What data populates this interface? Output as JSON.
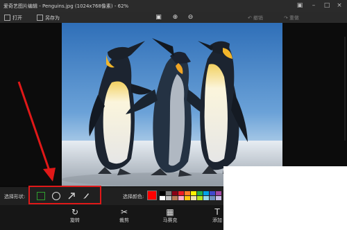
{
  "titlebar": {
    "title": "爱奇艺图片编辑 - Penguins.jpg (1024x768像素) - 62%"
  },
  "toolbar": {
    "open_label": "打开",
    "save_as_label": "另存为",
    "undo_label": "撤销",
    "redo_label": "重做"
  },
  "shape_panel": {
    "label": "选择形状:"
  },
  "color_panel": {
    "label": "选择颜色:",
    "current_color": "#ff0000",
    "swatches": [
      "#000000",
      "#7f7f7f",
      "#880015",
      "#ed1c24",
      "#ff7f27",
      "#fff200",
      "#22b14c",
      "#00a2e8",
      "#3f48cc",
      "#a349a4",
      "#ffffff",
      "#c3c3c3",
      "#b97a57",
      "#ffaec9",
      "#ffc90e",
      "#efe4b0",
      "#b5e61d",
      "#99d9ea",
      "#7092be",
      "#c8bfe7"
    ]
  },
  "bottom_tools": [
    {
      "label": "旋转",
      "icon": "rotate-icon"
    },
    {
      "label": "裁剪",
      "icon": "crop-icon"
    },
    {
      "label": "马赛克",
      "icon": "mosaic-icon"
    },
    {
      "label": "添加",
      "icon": "text-icon"
    }
  ],
  "colors": {
    "highlight": "#e01818",
    "selected_shape": "#2fa02f"
  }
}
